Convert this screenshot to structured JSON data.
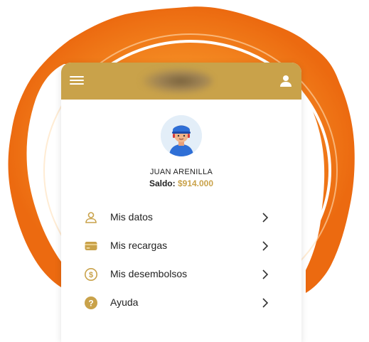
{
  "header": {
    "menu_icon": "hamburger-menu-icon",
    "profile_icon": "person-icon",
    "colors": {
      "bar": "#c9a24a",
      "icon": "#ffffff"
    }
  },
  "user": {
    "name": "JUAN ARENILLA",
    "balance_label": "Saldo:",
    "balance_value": "$914.000",
    "avatar_icon": "user-avatar-icon"
  },
  "menu": {
    "items": [
      {
        "label": "Mis datos",
        "icon": "person-outline-icon"
      },
      {
        "label": "Mis recargas",
        "icon": "wallet-icon"
      },
      {
        "label": "Mis desembolsos",
        "icon": "dollar-circle-icon"
      },
      {
        "label": "Ayuda",
        "icon": "help-circle-icon"
      }
    ]
  },
  "colors": {
    "accent": "#c9a24a",
    "splash": "#f07a1a",
    "text": "#222222"
  }
}
